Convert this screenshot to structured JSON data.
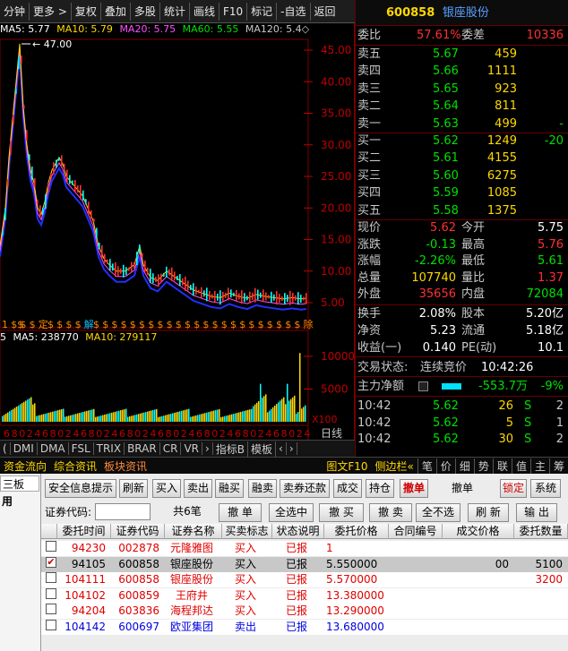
{
  "toolbar": {
    "items": [
      "分钟",
      "更多 >",
      "复权",
      "叠加",
      "多股",
      "统计",
      "画线",
      "F10",
      "标记",
      "-自选",
      "返回"
    ]
  },
  "ma_line": {
    "ma5": {
      "label": "MA5: 5.77",
      "color": "#ffffff"
    },
    "ma10": {
      "label": "MA10: 5.79",
      "color": "#ffd800"
    },
    "ma20": {
      "label": "MA20: 5.75",
      "color": "#ff4fff"
    },
    "ma60": {
      "label": "MA60: 5.55",
      "color": "#00e000"
    },
    "ma120": {
      "label": "MA120: 5.4◇",
      "color": "#c8c8c8"
    }
  },
  "price_chart": {
    "peak_label": "47.00",
    "y_ticks": [
      "45.00",
      "40.00",
      "35.00",
      "30.00",
      "25.00",
      "20.00",
      "15.00",
      "10.00",
      "5.00"
    ],
    "markers": [
      "1",
      "$$",
      "$",
      "$",
      "定",
      "$",
      "$",
      "$",
      "$",
      "解",
      "$",
      "$",
      "$",
      "$",
      "$",
      "$",
      "$",
      "$",
      "$",
      "$",
      "$",
      "$",
      "$",
      "$",
      "$",
      "$",
      "$",
      "$",
      "$",
      "$",
      "$",
      "$",
      "$",
      "除"
    ]
  },
  "volume_chart": {
    "label_prefix": "5",
    "ma5": "MA5: 238770",
    "ma10": "MA10: 279117",
    "y_ticks": [
      "10000",
      "5000"
    ],
    "unit": "X100"
  },
  "period_label": "日线",
  "axis_ticks": [
    "6",
    "8",
    "0",
    "2",
    "4",
    "6",
    "8",
    "0",
    "2",
    "4",
    "6",
    "8",
    "0",
    "2",
    "4",
    "6",
    "8",
    "0",
    "2",
    "4",
    "6",
    "8",
    "0",
    "2",
    "4",
    "6",
    "8",
    "0",
    "2",
    "4",
    "6",
    "8",
    "0",
    "2",
    "4",
    "6",
    "8",
    "0",
    "2",
    "4"
  ],
  "bottom_tabs": [
    "(",
    "DMI",
    "DMA",
    "FSL",
    "TRIX",
    "BRAR",
    "CR",
    "VR",
    "›",
    "指标B",
    "模板",
    "‹",
    "›"
  ],
  "quote": {
    "code": "600858",
    "name": "银座股份",
    "weibi": {
      "label": "委比",
      "value": "57.61%",
      "label2": "委差",
      "value2": "10336"
    },
    "asks": [
      {
        "label": "卖五",
        "price": "5.67",
        "vol": "459"
      },
      {
        "label": "卖四",
        "price": "5.66",
        "vol": "1111"
      },
      {
        "label": "卖三",
        "price": "5.65",
        "vol": "923"
      },
      {
        "label": "卖二",
        "price": "5.64",
        "vol": "811"
      },
      {
        "label": "卖一",
        "price": "5.63",
        "vol": "499",
        "extra": "-"
      }
    ],
    "bids": [
      {
        "label": "买一",
        "price": "5.62",
        "vol": "1249",
        "extra": "-20"
      },
      {
        "label": "买二",
        "price": "5.61",
        "vol": "4155"
      },
      {
        "label": "买三",
        "price": "5.60",
        "vol": "6275"
      },
      {
        "label": "买四",
        "price": "5.59",
        "vol": "1085"
      },
      {
        "label": "买五",
        "price": "5.58",
        "vol": "1375"
      }
    ],
    "stats": [
      {
        "l1": "现价",
        "v1": "5.62",
        "c1": "#ff3030",
        "l2": "今开",
        "v2": "5.75",
        "c2": "#ffffff"
      },
      {
        "l1": "涨跌",
        "v1": "-0.13",
        "c1": "#00e000",
        "l2": "最高",
        "v2": "5.76",
        "c2": "#ff3030"
      },
      {
        "l1": "涨幅",
        "v1": "-2.26%",
        "c1": "#00e000",
        "l2": "最低",
        "v2": "5.61",
        "c2": "#00e000"
      },
      {
        "l1": "总量",
        "v1": "107740",
        "c1": "#ffd800",
        "l2": "量比",
        "v2": "1.37",
        "c2": "#ff3030"
      },
      {
        "l1": "外盘",
        "v1": "35656",
        "c1": "#ff3030",
        "l2": "内盘",
        "v2": "72084",
        "c2": "#00e000"
      }
    ],
    "stats2": [
      {
        "l1": "换手",
        "v1": "2.08%",
        "l2": "股本",
        "v2": "5.20亿"
      },
      {
        "l1": "净资",
        "v1": "5.23",
        "l2": "流通",
        "v2": "5.18亿"
      },
      {
        "l1": "收益(一)",
        "v1": "0.140",
        "l2": "PE(动)",
        "v2": "10.1"
      }
    ],
    "trade_status": {
      "label": "交易状态:",
      "value": "连续竞价",
      "time": "10:42:26"
    },
    "net_flow": {
      "label": "主力净额",
      "value": "-553.7万",
      "pct": "-9%"
    },
    "ticks": [
      {
        "time": "10:42",
        "price": "5.62",
        "vol": "26",
        "side": "S",
        "n": "2"
      },
      {
        "time": "10:42",
        "price": "5.62",
        "vol": "5",
        "side": "S",
        "n": "1"
      },
      {
        "time": "10:42",
        "price": "5.62",
        "vol": "30",
        "side": "S",
        "n": "2"
      }
    ]
  },
  "midbar": {
    "left": [
      "资金流向",
      "综合资讯",
      "板块资讯"
    ],
    "right": [
      "图文F10",
      "侧边栏«",
      "笔",
      "价",
      "细",
      "势",
      "联",
      "值",
      "主",
      "筹"
    ]
  },
  "trade_panel": {
    "left_items": [
      "三板",
      "用"
    ],
    "buttons": [
      "安全信息提示",
      "刷新",
      "买入",
      "卖出",
      "融买",
      "融卖",
      "卖券还款",
      "成交",
      "持仓",
      "撤单",
      "撤单",
      "锁定",
      "系统"
    ],
    "code_label": "证券代码:",
    "code_value": "",
    "row2_buttons": [
      "共6笔",
      "撤 单",
      "全选中",
      "撤 买",
      "撤 卖",
      "全不选",
      "刷 新",
      "输 出"
    ],
    "columns": [
      "委托时间",
      "证券代码",
      "证券名称",
      "买卖标志",
      "状态说明",
      "委托价格",
      "合同编号",
      "成交价格",
      "委托数量"
    ],
    "rows": [
      {
        "time": "94230",
        "code": "002878",
        "name": "元隆雅图",
        "side": "买入",
        "status": "已报",
        "price": "1",
        "checked": false,
        "selected": false,
        "color": "#e00000"
      },
      {
        "time": "94105",
        "code": "600858",
        "name": "银座股份",
        "side": "买入",
        "status": "已报",
        "price": "5.550000",
        "fill": "00",
        "qty": "5100",
        "checked": true,
        "selected": true,
        "color": "#000000"
      },
      {
        "time": "104111",
        "code": "600858",
        "name": "银座股份",
        "side": "买入",
        "status": "已报",
        "price": "5.570000",
        "fill": "",
        "qty": "3200",
        "checked": false,
        "selected": false,
        "color": "#e00000"
      },
      {
        "time": "104102",
        "code": "600859",
        "name": "王府井",
        "side": "买入",
        "status": "已报",
        "price": "13.380000",
        "checked": false,
        "selected": false,
        "color": "#e00000"
      },
      {
        "time": "94204",
        "code": "603836",
        "name": "海程邦达",
        "side": "买入",
        "status": "已报",
        "price": "13.290000",
        "checked": false,
        "selected": false,
        "color": "#e00000"
      },
      {
        "time": "104142",
        "code": "600697",
        "name": "欧亚集团",
        "side": "卖出",
        "status": "已报",
        "price": "13.680000",
        "checked": false,
        "selected": false,
        "color": "#0000e0"
      }
    ]
  }
}
